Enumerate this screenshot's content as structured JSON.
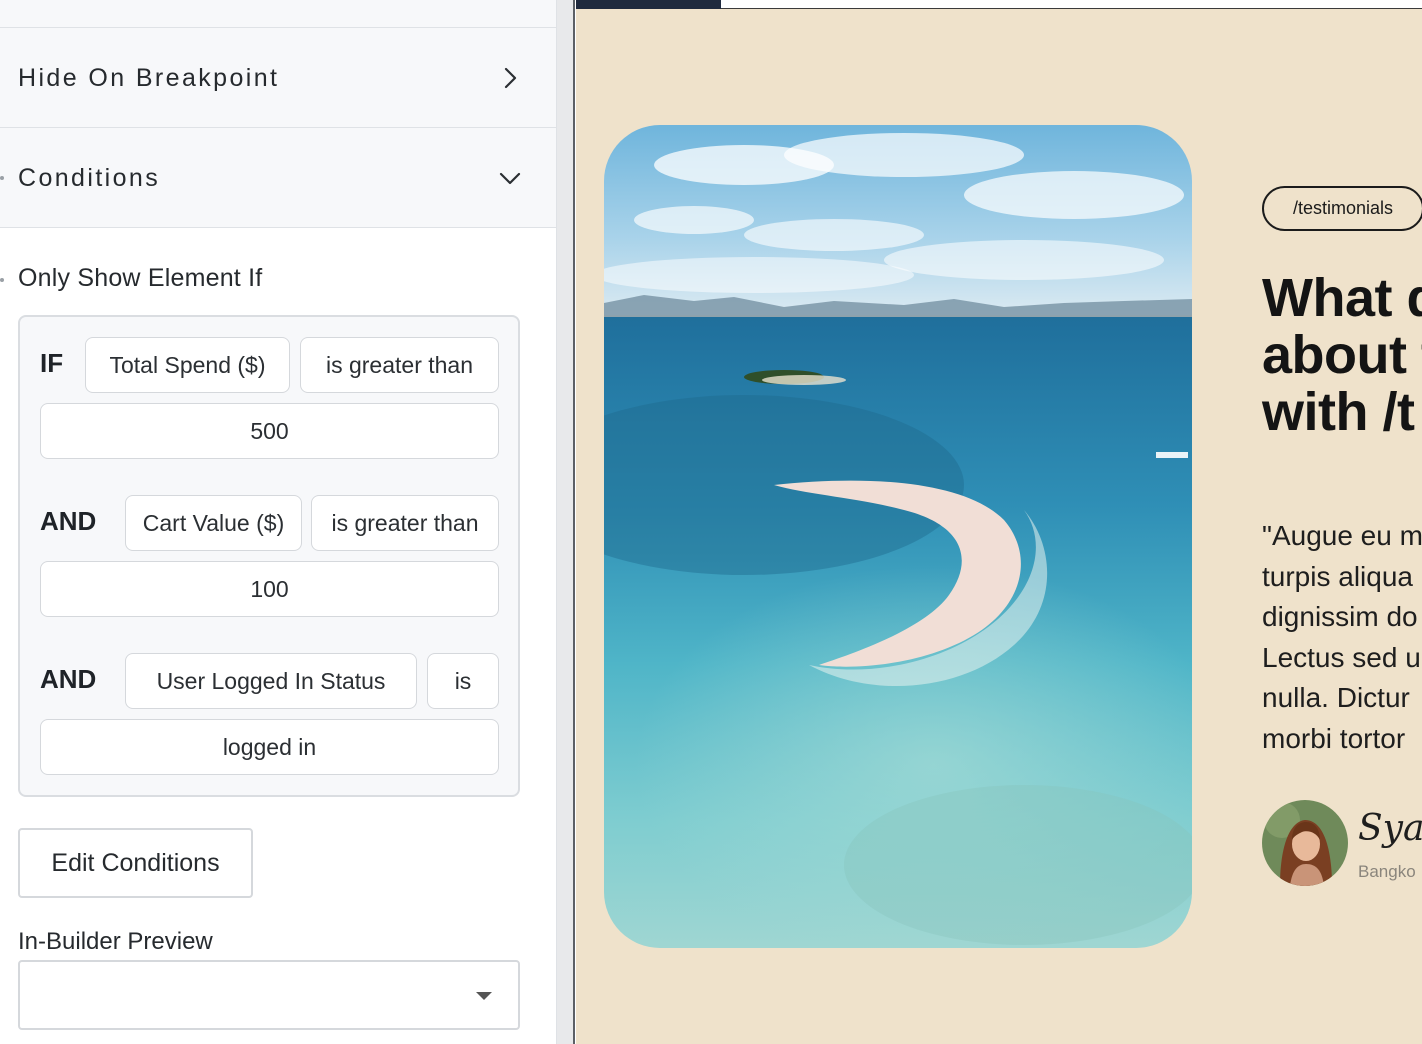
{
  "panel": {
    "hide_on_breakpoint": {
      "label": "Hide On Breakpoint",
      "icon": "chevron-right-icon"
    },
    "conditions": {
      "label": "Conditions",
      "icon": "chevron-down-icon",
      "heading": "Only Show Element If",
      "rules": [
        {
          "keyword": "IF",
          "field": "Total Spend ($)",
          "operator": "is greater than",
          "value": "500"
        },
        {
          "keyword": "AND",
          "field": "Cart Value ($)",
          "operator": "is greater than",
          "value": "100"
        },
        {
          "keyword": "AND",
          "field": "User Logged In Status",
          "operator": "is",
          "value": "logged in"
        }
      ],
      "edit_button": "Edit Conditions",
      "preview_label": "In-Builder Preview",
      "preview_value": ""
    }
  },
  "preview": {
    "tag": "/testimonials",
    "headline": [
      "What d",
      "about t",
      "with /t"
    ],
    "quote": [
      "\"Augue eu m",
      "turpis aliqua",
      "dignissim do",
      "Lectus sed u",
      "nulla. Dictur",
      "morbi tortor"
    ],
    "author_name": "Syara",
    "author_location": "Bangko"
  },
  "colors": {
    "canvas_bg": "#efe2cb",
    "panel_bg": "#f7f8fa",
    "text_dark": "#141414",
    "muted": "#8a857c"
  }
}
